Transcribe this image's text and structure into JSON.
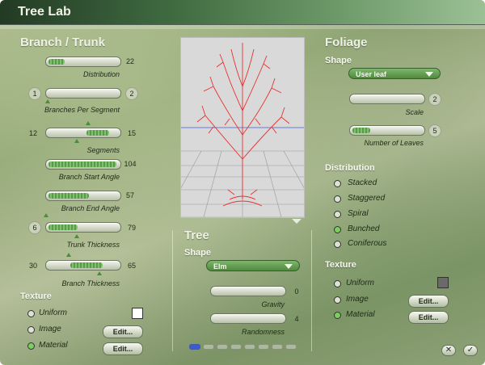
{
  "window": {
    "title": "Tree Lab"
  },
  "branch": {
    "heading": "Branch / Trunk",
    "sliders": [
      {
        "label": "Distribution",
        "value": "22",
        "fill": 0.22
      },
      {
        "label": "Branches Per Segment",
        "min": "1",
        "value": "2",
        "fill": 0.0
      },
      {
        "label": "Segments",
        "min": "12",
        "value": "15",
        "fill": 0.45
      },
      {
        "label": "Branch Start Angle",
        "value": "104",
        "fill": 0.95
      },
      {
        "label": "Branch End Angle",
        "value": "57",
        "fill": 0.55
      },
      {
        "label": "Trunk Thickness",
        "min": "6",
        "value": "79",
        "fill": 0.42
      },
      {
        "label": "Branch Thickness",
        "min": "30",
        "value": "65",
        "fill": 0.5
      }
    ],
    "texture": {
      "heading": "Texture",
      "options": [
        {
          "label": "Uniform",
          "selected": false
        },
        {
          "label": "Image",
          "selected": false
        },
        {
          "label": "Material",
          "selected": true
        }
      ],
      "edit_label": "Edit...",
      "color": "#ffffff"
    }
  },
  "tree": {
    "heading": "Tree",
    "shape_label": "Shape",
    "shape_value": "Elm",
    "sliders": [
      {
        "label": "Gravity",
        "value": "0"
      },
      {
        "label": "Randomness",
        "value": "4"
      }
    ],
    "pages": 8,
    "active_page": 0
  },
  "foliage": {
    "heading": "Foliage",
    "shape_label": "Shape",
    "shape_value": "User leaf",
    "sliders": [
      {
        "label": "Scale",
        "value": "2",
        "fill": 0.0
      },
      {
        "label": "Number of Leaves",
        "value": "5",
        "fill": 0.2
      }
    ],
    "distribution": {
      "heading": "Distribution",
      "options": [
        {
          "label": "Stacked",
          "selected": false
        },
        {
          "label": "Staggered",
          "selected": false
        },
        {
          "label": "Spiral",
          "selected": false
        },
        {
          "label": "Bunched",
          "selected": true
        },
        {
          "label": "Coniferous",
          "selected": false
        }
      ]
    },
    "texture": {
      "heading": "Texture",
      "options": [
        {
          "label": "Uniform",
          "selected": false
        },
        {
          "label": "Image",
          "selected": false
        },
        {
          "label": "Material",
          "selected": true
        }
      ],
      "edit_label": "Edit...",
      "color": "#6a6a6a"
    }
  },
  "footer": {
    "cancel_symbol": "✕",
    "ok_symbol": "✓"
  },
  "colors": {
    "accent": "#5a9a4c",
    "tree": "#e8322f",
    "horizon": "#3b5ad6"
  }
}
